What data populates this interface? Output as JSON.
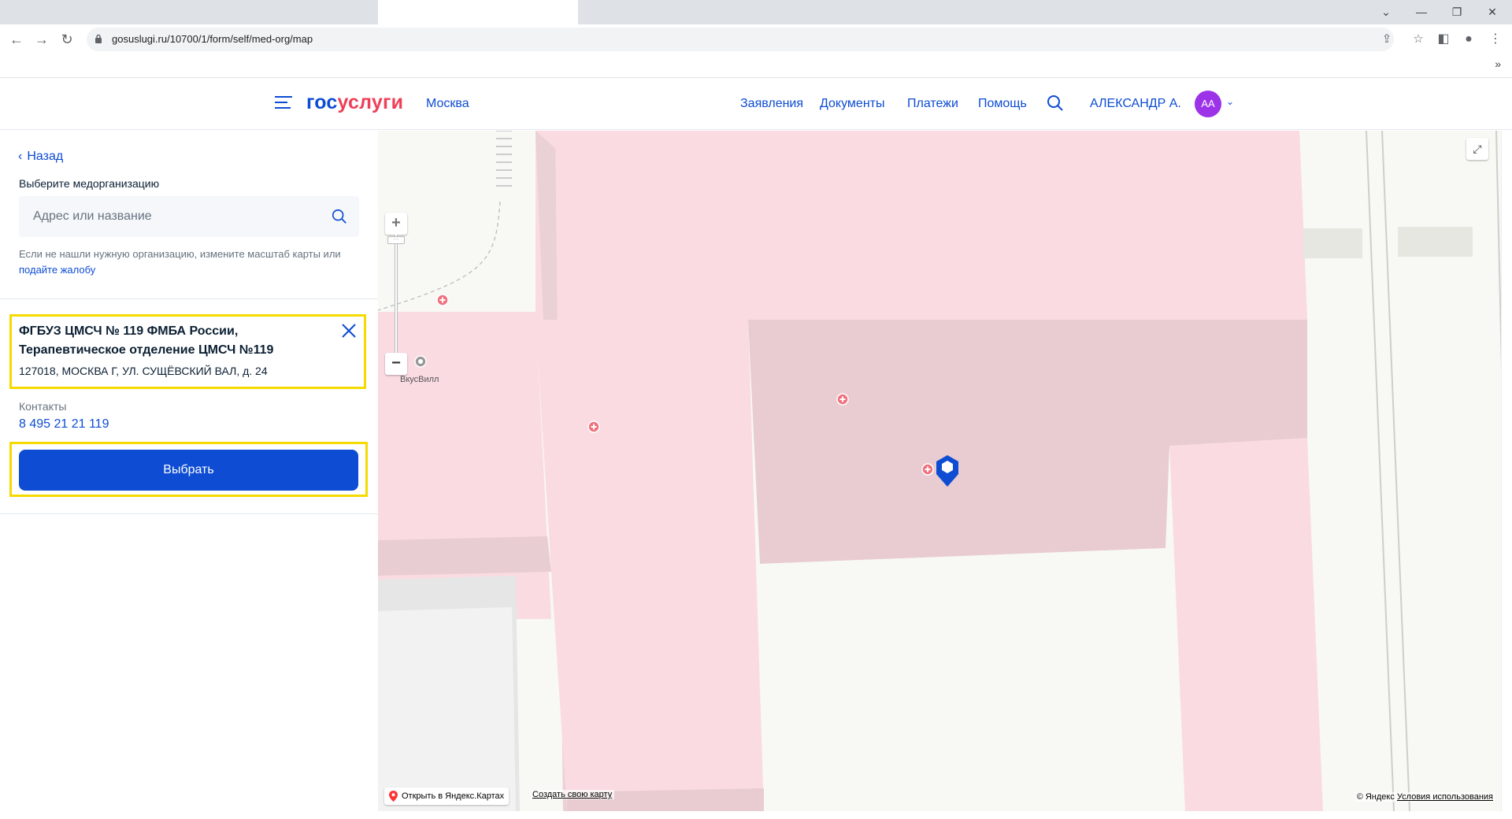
{
  "browser": {
    "url": "gosuslugi.ru/10700/1/form/self/med-org/map",
    "bookmarks_more": "»"
  },
  "header": {
    "logo_part1": "гос",
    "logo_part2": "услуги",
    "city": "Москва",
    "nav": [
      "Заявления",
      "Документы",
      "Платежи",
      "Помощь"
    ],
    "user_name": "АЛЕКСАНДР А.",
    "avatar_initials": "АА",
    "brand_color": "#0d4cd3",
    "accent_color": "#ee3f58"
  },
  "panel": {
    "back_label": "Назад",
    "select_title": "Выберите медорганизацию",
    "search_placeholder": "Адрес или название",
    "hint_text": "Если не нашли нужную организацию, измените масштаб карты или ",
    "hint_link": "подайте жалобу",
    "org": {
      "name_line1": "ФГБУЗ ЦМСЧ № 119 ФМБА России,",
      "name_line2": "Терапевтическое отделение ЦМСЧ №119",
      "address": "127018, МОСКВА Г, УЛ. СУЩЁВСКИЙ ВАЛ, д. 24"
    },
    "contacts_label": "Контакты",
    "phone": "8 495 21 21 119",
    "select_button": "Выбрать",
    "highlight_color": "#f5da00"
  },
  "map": {
    "poi_label": "ВкусВилл",
    "open_yandex": "Открыть в Яндекс.Картах",
    "create_map": "Создать свою карту",
    "copyright_prefix": "© Яндекс ",
    "copyright_link": "Условия использования"
  }
}
